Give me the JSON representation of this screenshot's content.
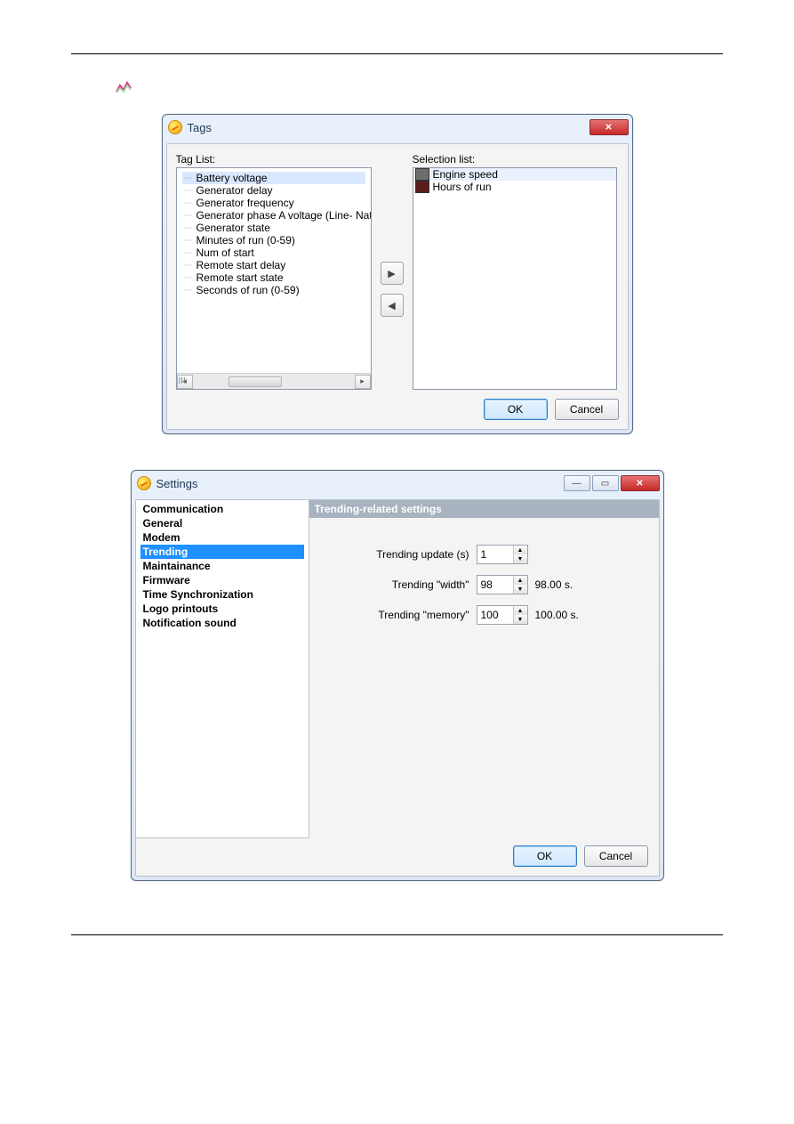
{
  "tags_dialog": {
    "title": "Tags",
    "tag_list_label": "Tag List:",
    "selection_list_label": "Selection list:",
    "tag_items": [
      "Battery voltage",
      "Generator delay",
      "Generator frequency",
      "Generator phase A voltage (Line- Natu",
      "Generator state",
      "Minutes of run (0-59)",
      "Num of start",
      "Remote start delay",
      "Remote start state",
      "Seconds of run (0-59)"
    ],
    "tag_selected_index": 0,
    "scroll_marker": "III",
    "move_right": "▶",
    "move_left": "◀",
    "selection_items": [
      {
        "label": "Engine speed",
        "swatch": "sw-gray"
      },
      {
        "label": "Hours of run",
        "swatch": "sw-dark"
      }
    ],
    "ok": "OK",
    "cancel": "Cancel",
    "close_x": "✕"
  },
  "settings_dialog": {
    "title": "Settings",
    "min_icon": "—",
    "max_icon": "▭",
    "close_x": "✕",
    "sidebar": [
      "Communication",
      "General",
      "Modem",
      "Trending",
      "Maintainance",
      "Firmware",
      "Time Synchronization",
      "Logo printouts",
      "Notification sound"
    ],
    "sidebar_selected_index": 3,
    "panel_header": "Trending-related settings",
    "fields": {
      "update_label": "Trending update (s)",
      "update_value": "1",
      "width_label": "Trending \"width\"",
      "width_value": "98",
      "width_suffix": "98.00 s.",
      "memory_label": "Trending \"memory\"",
      "memory_value": "100",
      "memory_suffix": "100.00 s."
    },
    "ok": "OK",
    "cancel": "Cancel"
  }
}
